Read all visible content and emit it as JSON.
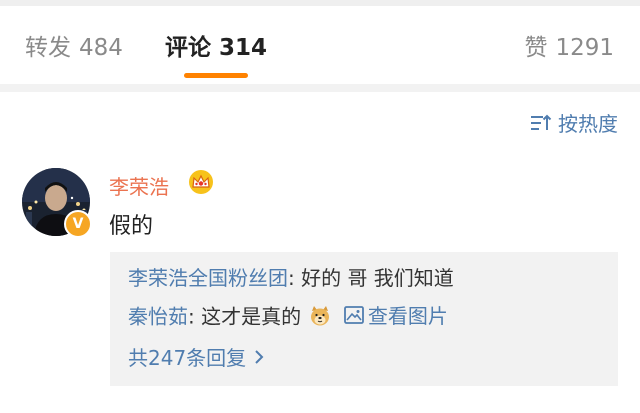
{
  "tabs": {
    "repost": {
      "label": "转发",
      "count": "484"
    },
    "comment": {
      "label": "评论",
      "count": "314"
    },
    "like": {
      "label": "赞",
      "count": "1291"
    }
  },
  "accent_color": "#ff8200",
  "link_color": "#507daf",
  "sort": {
    "label": "按热度",
    "icon": "sort-icon"
  },
  "comment": {
    "author": "李荣浩",
    "author_color": "#eb7350",
    "badges": [
      "crown-icon",
      "verified-v-icon"
    ],
    "verified_letter": "V",
    "text": "假的",
    "replies": [
      {
        "name": "李荣浩全国粉丝团",
        "text": ": 好的 哥 我们知道"
      },
      {
        "name": "秦怡茹",
        "text": ": 这才是真的",
        "emoji": "doge-emoji-icon",
        "link": "查看图片",
        "link_icon": "image-icon"
      }
    ],
    "more_replies": "共247条回复",
    "more_icon": "chevron-right-icon"
  }
}
